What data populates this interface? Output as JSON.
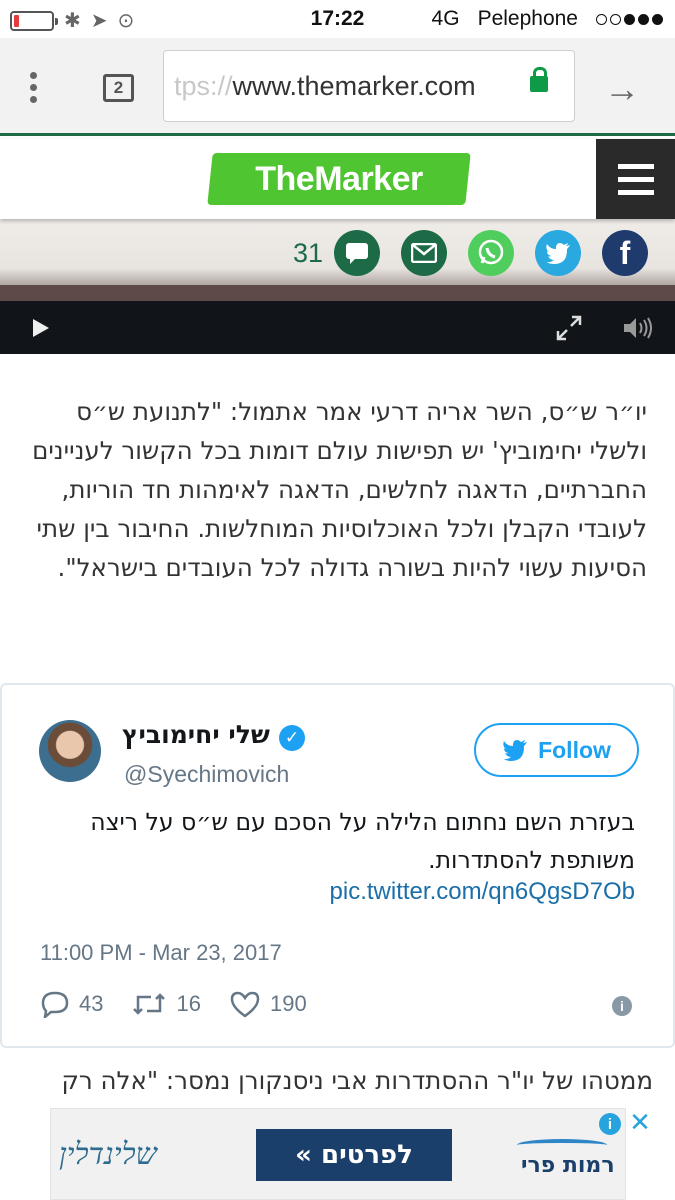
{
  "status_bar": {
    "time": "17:22",
    "network": "4G",
    "carrier": "Pelephone",
    "battery_level": 0.15,
    "signal_bars_filled": 3,
    "signal_bars_total": 5
  },
  "browser": {
    "tab_count": "2",
    "url_faded": "tps://",
    "url_main": "www.themarker.com",
    "secure": true
  },
  "site": {
    "logo_text": "TheMarker",
    "logo_color": "#4fc531",
    "share_count": "31",
    "share_colors": {
      "comments": "#1c6b46",
      "mail": "#1c6b46",
      "whatsapp": "#4fce5d",
      "twitter": "#2aa9e0",
      "facebook": "#1f3b6e"
    }
  },
  "article": {
    "paragraph": "יו״ר ש״ס, השר אריה דרעי אמר אתמול: \"לתנועת ש״ס ולשלי יחימוביץ' יש תפישות עולם דומות בכל הקשור לעניינים החברתיים, הדאגה לחלשים, הדאגה לאימהות חד הוריות, לעובדי הקבלן ולכל האוכלוסיות המוחלשות. החיבור בין שתי הסיעות עשוי להיות בשורה גדולה לכל העובדים בישראל\".",
    "next_line": "ממטהו של יו\"ר ההסתדרות אבי ניסנקורן נמסר: \"אלה רק"
  },
  "tweet": {
    "name": "שלי יחימוביץ",
    "handle": "@Syechimovich",
    "follow_label": "Follow",
    "text": "בעזרת השם נחתום הלילה על הסכם עם ש״ס על ריצה משותפת להסתדרות.",
    "link": "pic.twitter.com/qn6QgsD7Ob",
    "date": "11:00 PM - Mar 23, 2017",
    "replies": "43",
    "retweets": "16",
    "likes": "190",
    "accent_color": "#1da1f2"
  },
  "ad": {
    "left_brand": "שלינדלין",
    "cta": "לפרטים »",
    "right_brand": "רמות פרי",
    "info": "i",
    "close": "✕"
  }
}
